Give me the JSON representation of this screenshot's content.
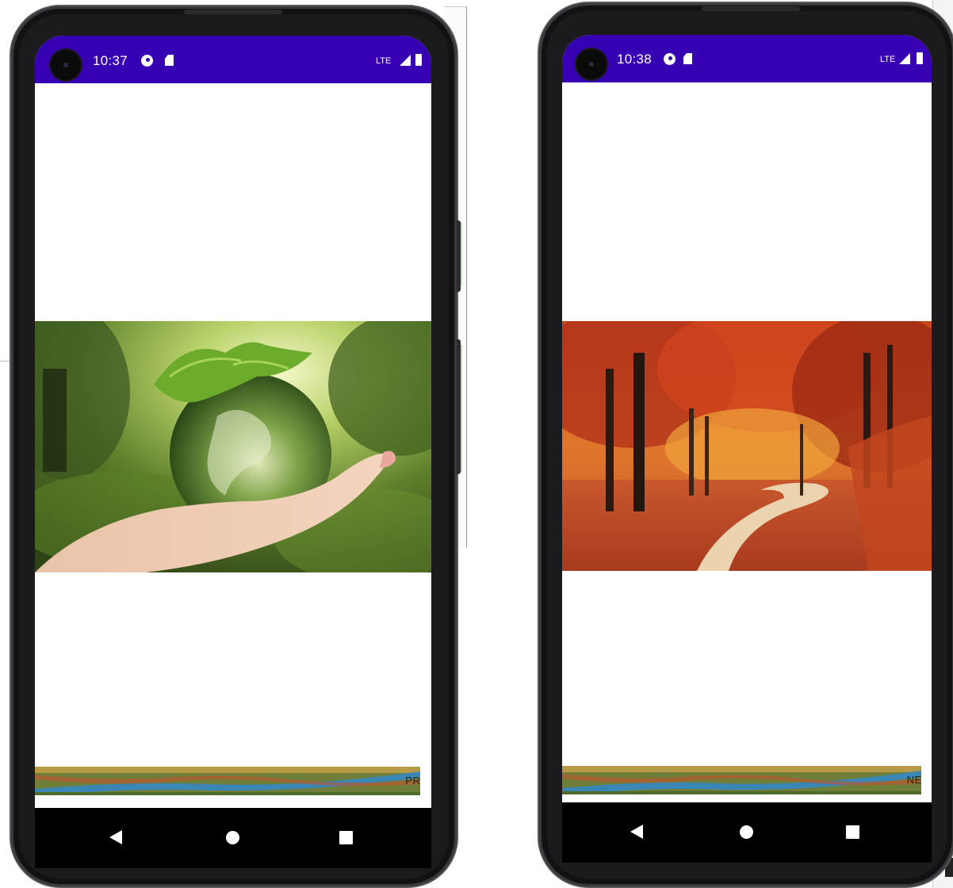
{
  "screens": [
    {
      "status_bar": {
        "time": "10:37",
        "network": "LTE"
      },
      "main_image": {
        "subject": "hand holding green globe with leaves",
        "icon": "globe-in-hand-image"
      },
      "button": {
        "label": "PREV"
      },
      "nav": {
        "back_icon": "back-triangle-icon",
        "home_icon": "home-circle-icon",
        "recents_icon": "recents-square-icon"
      }
    },
    {
      "status_bar": {
        "time": "10:38",
        "network": "LTE"
      },
      "main_image": {
        "subject": "autumn forest path with red and orange trees",
        "icon": "autumn-forest-image"
      },
      "button": {
        "label": "NEXT"
      },
      "nav": {
        "back_icon": "back-triangle-icon",
        "home_icon": "home-circle-icon",
        "recents_icon": "recents-square-icon"
      }
    }
  ],
  "colors": {
    "status_bar": "#3700b3",
    "screen_bg": "#ffffff",
    "nav_bar": "#000000",
    "phone_body": "#1b1b1d"
  }
}
